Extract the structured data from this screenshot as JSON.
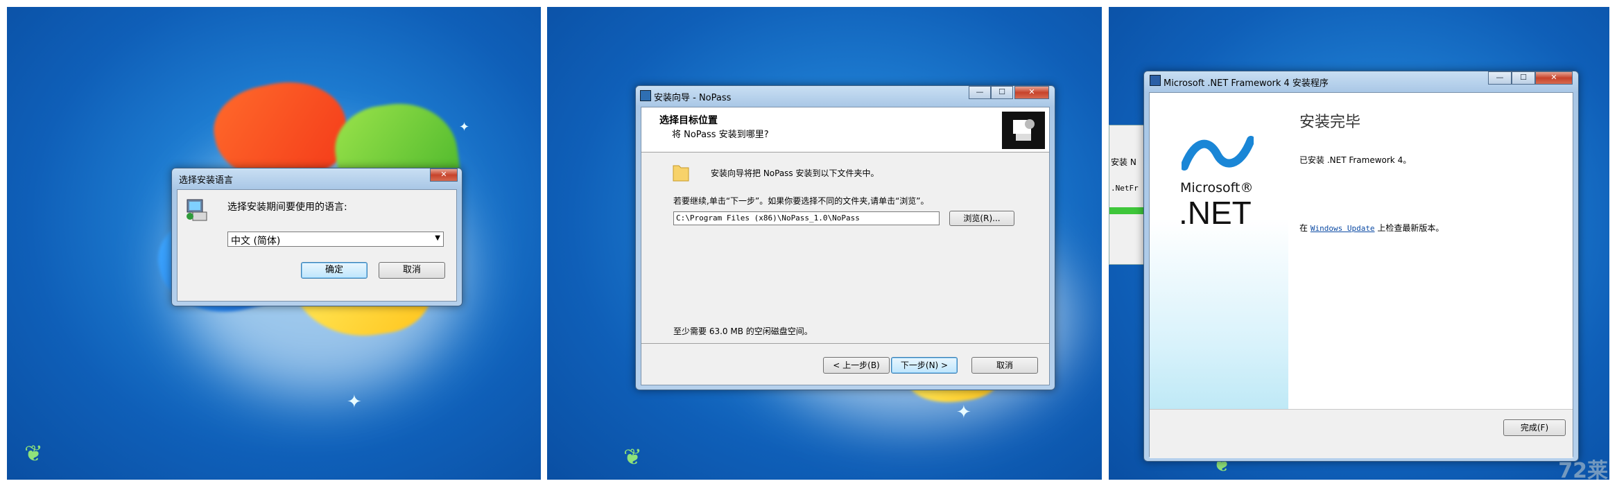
{
  "screen1": {
    "dialog_title": "选择安装语言",
    "prompt": "选择安装期间要使用的语言:",
    "language_selected": "中文 (简体)",
    "ok_button": "确定",
    "cancel_button": "取消"
  },
  "screen2": {
    "window_title": "安装向导 - NoPass",
    "header_title": "选择目标位置",
    "header_subtitle": "将 NoPass 安装到哪里?",
    "info_text": "安装向导将把 NoPass 安装到以下文件夹中。",
    "instruction_text": "若要继续,单击“下一步”。如果你要选择不同的文件夹,请单击“浏览”。",
    "install_path": "C:\\Program Files (x86)\\NoPass_1.0\\NoPass",
    "browse_button": "浏览(R)...",
    "space_text": "至少需要 63.0 MB 的空闲磁盘空间。",
    "back_button": "< 上一步(B)",
    "next_button": "下一步(N) >",
    "cancel_button": "取消"
  },
  "screen3": {
    "window_title": "Microsoft .NET Framework 4 安装程序",
    "logo_top": "Microsoft®",
    "logo_bottom": ".NET",
    "heading": "安装完毕",
    "installed_text": "已安装 .NET Framework 4。",
    "update_prefix": "在",
    "update_link": "Windows Update",
    "update_suffix": "上检查最新版本。",
    "finish_button": "完成(F)",
    "behind_text_1": "安装 N",
    "behind_text_2": ".NetFr"
  },
  "watermark": "72莱",
  "colors": {
    "desktop_blue": "#1d7bd0",
    "title_bar": "#b5d0ec",
    "dialog_face": "#f0f0f0",
    "link": "#0b4aa3",
    "progress_green": "#3ec63a"
  }
}
